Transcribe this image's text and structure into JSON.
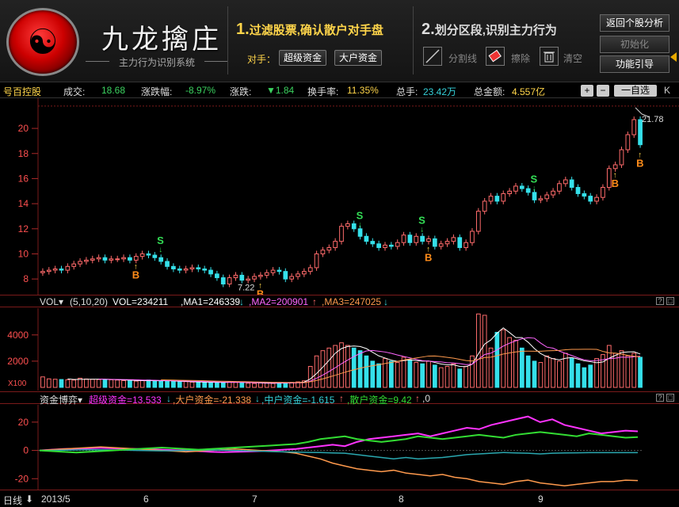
{
  "header": {
    "brand_title": "九龙擒庄",
    "brand_subtitle": "主力行为识别系统",
    "step1_num": "1.",
    "step1_text": "过滤股票,确认散户对手盘",
    "step2_num": "2.",
    "step2_text": "划分区段,识别主力行为",
    "opponent_label": "对手：",
    "btn_super": "超级资金",
    "btn_large": "大户资金",
    "tool_divider": "分割线",
    "tool_erase": "擦除",
    "tool_clear": "清空",
    "btn_back": "返回个股分析",
    "btn_init": "初始化",
    "btn_guide": "功能引导"
  },
  "infobar": {
    "stock_name": "号百控股",
    "vol_label": "成交:",
    "vol_value": "18.68",
    "chgpct_label": "涨跌幅:",
    "chgpct_value": "-8.97%",
    "chg_label": "涨跌:",
    "chg_value": "▼1.84",
    "turnover_label": "换手率:",
    "turnover_value": "11.35%",
    "total_hand_label": "总手:",
    "total_hand_value": "23.42万",
    "amount_label": "总金额:",
    "amount_value": "4.557亿",
    "btn_plus": "+",
    "btn_minus": "−",
    "btn_watchlist": "一自选",
    "btn_k": "K"
  },
  "price_panel": {
    "high_label": "21.78",
    "low_label": "7.22",
    "marker_buy": "B",
    "marker_sell": "S"
  },
  "vol_panel": {
    "title": "VOL▾",
    "params": "(5,10,20)",
    "vol": "VOL=234211",
    "ma1": ",MA1=246339",
    "ma2": ",MA2=200901",
    "ma3": ",MA3=247025",
    "unit": "X100"
  },
  "fund_panel": {
    "title": "资金博弈▾",
    "super": "超级资金=13.533",
    "large": ",大户资金=-21.338",
    "medium": ",中户资金=-1.615",
    "retail": ",散户资金=9.42",
    "tail": ",0"
  },
  "bottom": {
    "period": "日线",
    "dates": [
      "2013/5",
      "6",
      "7",
      "8",
      "9"
    ]
  },
  "colors": {
    "up": "#ff6b6b",
    "down": "#35e0ea",
    "super": "#ff33ff",
    "large": "#ff9a4d",
    "medium": "#2aa8b0",
    "retail": "#33dd33"
  },
  "chart_data": [
    {
      "type": "candlestick",
      "name": "price",
      "yticks": [
        8,
        10,
        12,
        14,
        16,
        18,
        20
      ],
      "ylim": [
        7,
        21.9
      ],
      "high": 21.78,
      "low": 7.22,
      "closes": [
        8.6,
        8.7,
        8.8,
        8.7,
        9.0,
        9.2,
        9.4,
        9.5,
        9.6,
        9.7,
        9.5,
        9.6,
        9.6,
        9.7,
        9.5,
        9.8,
        10.0,
        9.9,
        9.7,
        9.4,
        9.0,
        8.8,
        8.7,
        8.8,
        8.9,
        8.8,
        8.7,
        8.4,
        8.1,
        7.6,
        8.1,
        8.3,
        7.9,
        8.0,
        8.2,
        8.3,
        8.5,
        8.7,
        8.6,
        8.0,
        8.2,
        8.4,
        8.6,
        8.9,
        10.0,
        10.3,
        10.5,
        11.0,
        12.2,
        12.4,
        12.0,
        11.4,
        11.0,
        10.8,
        10.5,
        10.7,
        10.6,
        10.9,
        11.5,
        10.9,
        11.4,
        11.0,
        11.2,
        10.6,
        10.8,
        11.0,
        11.3,
        10.5,
        10.9,
        11.8,
        13.4,
        14.2,
        14.6,
        14.2,
        14.8,
        15.0,
        15.4,
        15.2,
        14.9,
        14.3,
        14.4,
        14.7,
        15.0,
        15.6,
        15.9,
        15.3,
        14.8,
        14.6,
        14.2,
        14.5,
        15.3,
        16.8,
        17.1,
        18.3,
        19.5,
        20.7,
        18.7
      ],
      "buy_markers": [
        15,
        35,
        62,
        92,
        113
      ],
      "sell_markers": [
        19,
        51,
        61,
        79
      ],
      "note": "indices refer to the candle sequence"
    },
    {
      "type": "bar",
      "name": "volume",
      "yticks": [
        2000,
        4000
      ],
      "ylim": [
        0,
        5800
      ],
      "values": [
        800,
        650,
        620,
        600,
        580,
        560,
        700,
        640,
        620,
        600,
        590,
        580,
        560,
        520,
        500,
        480,
        520,
        560,
        500,
        480,
        460,
        450,
        420,
        440,
        400,
        380,
        360,
        380,
        400,
        360,
        420,
        380,
        360,
        320,
        300,
        340,
        320,
        300,
        360,
        340,
        380,
        420,
        500,
        1600,
        2400,
        2800,
        3000,
        3200,
        3400,
        3200,
        3000,
        2800,
        2400,
        2000,
        1800,
        2200,
        2000,
        1900,
        2300,
        2100,
        1900,
        1800,
        2000,
        1700,
        1500,
        1600,
        1800,
        1400,
        1600,
        2400,
        5600,
        5500,
        3000,
        4200,
        4400,
        3800,
        3600,
        3000,
        2400,
        2000,
        1900,
        2400,
        2200,
        2000,
        2600,
        2200,
        1800,
        1500,
        1700,
        2200,
        2500,
        3200,
        2600,
        2800,
        2400,
        2600,
        2300
      ]
    },
    {
      "type": "line",
      "name": "fund_flow",
      "yticks": [
        20,
        0,
        -20
      ],
      "ylim": [
        -26,
        30
      ],
      "series": [
        {
          "name": "超级资金",
          "values": [
            0,
            0.5,
            1,
            1.2,
            1.5,
            1.8,
            1.5,
            1.2,
            1,
            0.8,
            0.5,
            0.2,
            0,
            -0.5,
            -1,
            -1.2,
            -1,
            -0.8,
            -0.5,
            0,
            0.5,
            1,
            2,
            3,
            4,
            3,
            6,
            8,
            9,
            10,
            11,
            12,
            10,
            12,
            14,
            16,
            15,
            18,
            20,
            22,
            24,
            20,
            22,
            18,
            16,
            14,
            12,
            13,
            14,
            13.5
          ]
        },
        {
          "name": "大户资金",
          "values": [
            0,
            0.5,
            1,
            1.5,
            2,
            2.5,
            2,
            1.5,
            1,
            0.5,
            0,
            -0.5,
            -1,
            -0.5,
            0,
            0.5,
            1,
            0.5,
            0,
            -0.5,
            -1,
            -2,
            -4,
            -6,
            -9,
            -11,
            -13,
            -14,
            -15,
            -14,
            -16,
            -17,
            -18,
            -17,
            -19,
            -20,
            -22,
            -23,
            -24,
            -22,
            -21,
            -23,
            -24,
            -25,
            -24,
            -23,
            -22,
            -22,
            -21,
            -21.3
          ]
        },
        {
          "name": "中户资金",
          "values": [
            0,
            0,
            0.2,
            0.3,
            0.5,
            0.4,
            0.3,
            0.2,
            0,
            -0.2,
            -0.3,
            -0.2,
            0,
            0.2,
            0.3,
            0.2,
            0,
            -0.3,
            -0.5,
            -0.8,
            -1,
            -1.2,
            -1.4,
            -1.5,
            -1.8,
            -2,
            -3,
            -4,
            -5,
            -6,
            -5,
            -6,
            -5.5,
            -5,
            -4,
            -3,
            -2.5,
            -2,
            -1.5,
            -1.8,
            -2,
            -2.5,
            -2,
            -1.8,
            -1.7,
            -1.6,
            -1.6,
            -1.6,
            -1.6,
            -1.6
          ]
        },
        {
          "name": "散户资金",
          "values": [
            0,
            -0.5,
            -1,
            -1.5,
            -1,
            -0.5,
            0,
            0.5,
            1,
            1.5,
            2,
            1.5,
            1,
            0.5,
            1,
            1.5,
            2,
            2.5,
            3,
            3.5,
            4,
            4.5,
            6,
            8,
            9,
            10,
            8,
            7,
            6,
            7,
            8,
            10,
            9,
            8,
            9,
            10,
            11,
            10,
            9,
            11,
            12,
            13,
            12,
            11,
            10,
            12,
            11,
            10,
            9,
            9.4
          ]
        }
      ]
    }
  ]
}
